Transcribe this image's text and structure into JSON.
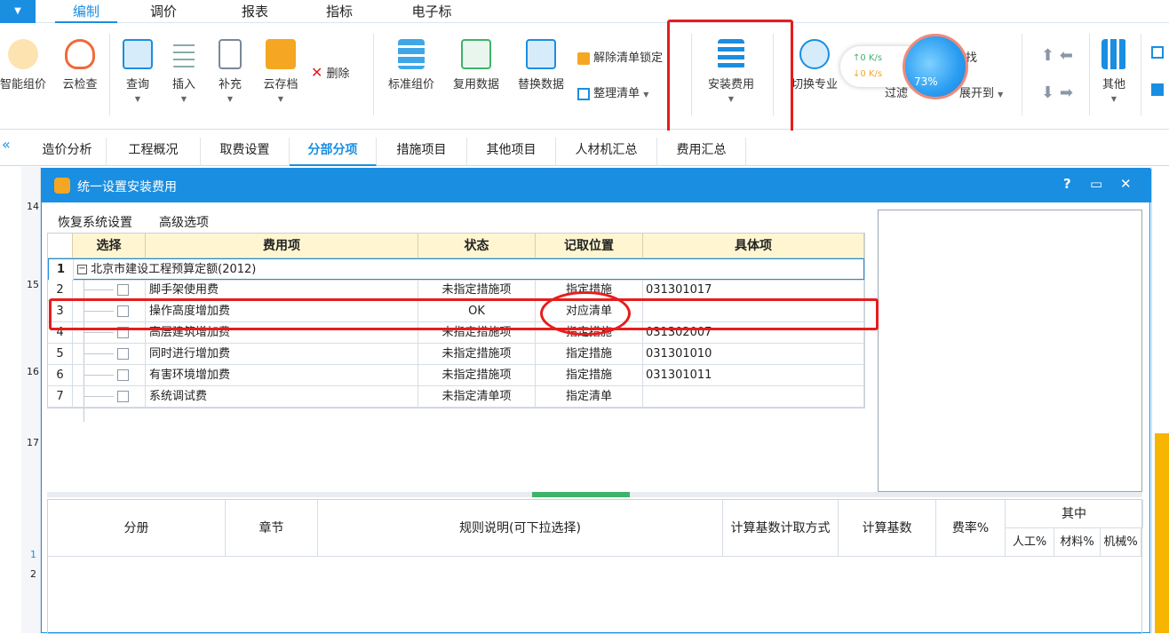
{
  "menubar": {
    "items": [
      {
        "label": "编制",
        "active": true
      },
      {
        "label": "调价"
      },
      {
        "label": "报表"
      },
      {
        "label": "指标"
      },
      {
        "label": "电子标"
      }
    ],
    "dropdown": "▼"
  },
  "ribbon": {
    "buttons": [
      {
        "label": "智能组价",
        "icon": "coin-cloud-icon",
        "color": "#f5a623"
      },
      {
        "label": "云检查",
        "icon": "cloud-check-icon",
        "color": "#f06a3a"
      },
      {
        "label": "查询",
        "icon": "book-search-icon",
        "color": "#1a8ee1"
      },
      {
        "label": "插入",
        "icon": "insert-row-icon",
        "color": "#1a8ee1"
      },
      {
        "label": "补充",
        "icon": "doc-plus-icon",
        "color": "#1a8ee1"
      },
      {
        "label": "云存档",
        "icon": "cloud-archive-icon",
        "color": "#f5a623"
      },
      {
        "label": "删除",
        "icon": "delete-x-icon",
        "color": "#e81c1c"
      },
      {
        "label": "标准组价",
        "icon": "standard-price-icon",
        "color": "#1a8ee1"
      },
      {
        "label": "复用数据",
        "icon": "reuse-data-icon",
        "color": "#3fb36a"
      },
      {
        "label": "替换数据",
        "icon": "replace-data-icon",
        "color": "#1a8ee1"
      },
      {
        "label": "解除清单锁定",
        "icon": "unlock-icon",
        "color": "#f5a623"
      },
      {
        "label": "整理清单",
        "icon": "organize-list-icon",
        "color": "#1a8ee1"
      },
      {
        "label": "安装费用",
        "icon": "install-fee-icon",
        "color": "#1a8ee1"
      },
      {
        "label": "切换专业",
        "icon": "switch-major-icon",
        "color": "#1a8ee1"
      },
      {
        "label": "查找",
        "icon": "find-icon",
        "color": "#1a8ee1"
      },
      {
        "label": "过滤",
        "icon": "filter-icon",
        "color": "#1a8ee1"
      },
      {
        "label": "展开到",
        "icon": "expand-icon",
        "color": "#1a8ee1"
      },
      {
        "label": "其他",
        "icon": "grid-other-icon",
        "color": "#1a8ee1"
      }
    ],
    "net": {
      "up": "↑0 K/s",
      "down": "↓0 K/s",
      "percent": "73%"
    }
  },
  "tabs": [
    {
      "label": "造价分析"
    },
    {
      "label": "工程概况"
    },
    {
      "label": "取费设置"
    },
    {
      "label": "分部分项",
      "active": true
    },
    {
      "label": "措施项目"
    },
    {
      "label": "其他项目"
    },
    {
      "label": "人材机汇总"
    },
    {
      "label": "费用汇总"
    }
  ],
  "leftgrid": {
    "rows": [
      "14",
      "15",
      "16",
      "17",
      "1",
      "2"
    ],
    "collapse": "«"
  },
  "dialog": {
    "title": "统一设置安装费用",
    "controls": {
      "help": "?",
      "max": "▭",
      "close": "✕"
    },
    "links": [
      "恢复系统设置",
      "高级选项"
    ],
    "columns": [
      "选择",
      "费用项",
      "状态",
      "记取位置",
      "具体项"
    ],
    "rows": [
      {
        "num": "1",
        "name": "北京市建设工程预算定额(2012)",
        "group": true
      },
      {
        "num": "2",
        "name": "脚手架使用费",
        "status": "未指定措施项",
        "pos": "指定措施",
        "item": "031301017"
      },
      {
        "num": "3",
        "name": "操作高度增加费",
        "status": "OK",
        "pos": "对应清单",
        "item": ""
      },
      {
        "num": "4",
        "name": "高层建筑增加费",
        "status": "未指定措施项",
        "pos": "指定措施",
        "item": "031302007"
      },
      {
        "num": "5",
        "name": "同时进行增加费",
        "status": "未指定措施项",
        "pos": "指定措施",
        "item": "031301010"
      },
      {
        "num": "6",
        "name": "有害环境增加费",
        "status": "未指定措施项",
        "pos": "指定措施",
        "item": "031301011"
      },
      {
        "num": "7",
        "name": "系统调试费",
        "status": "未指定清单项",
        "pos": "指定清单",
        "item": ""
      }
    ],
    "lower_columns": [
      "分册",
      "章节",
      "规则说明(可下拉选择)",
      "计算基数计取方式",
      "计算基数",
      "费率%",
      "其中",
      "人工%",
      "材料%",
      "机械%"
    ]
  }
}
